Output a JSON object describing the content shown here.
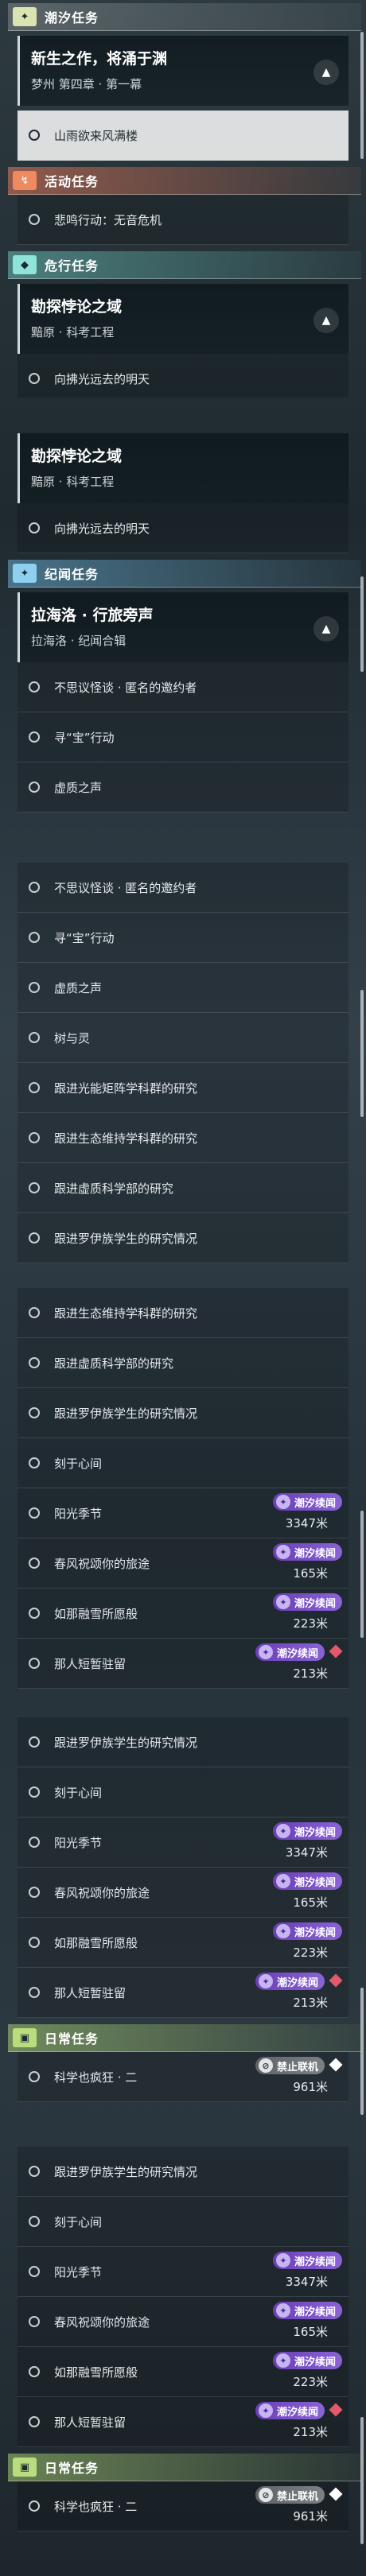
{
  "sections": {
    "tide": {
      "title": "潮汐任务",
      "icon": "star-icon",
      "glyph": "✦"
    },
    "activity": {
      "title": "活动任务",
      "icon": "event-icon",
      "glyph": "↯"
    },
    "danger": {
      "title": "危行任务",
      "icon": "hazard-icon",
      "glyph": "◆"
    },
    "epoch": {
      "title": "纪闻任务",
      "icon": "epoch-icon",
      "glyph": "✦"
    },
    "daily": {
      "title": "日常任务",
      "icon": "daily-icon",
      "glyph": "▣"
    }
  },
  "quests": {
    "main": {
      "title": "新生之作，将涌于渊",
      "subtitle": "梦州 第四章 · 第一幕"
    },
    "kantan": {
      "title": "勘探悖论之域",
      "subtitle": "黯原 · 科考工程"
    },
    "lahailuo": {
      "title": "拉海洛 · 行旅旁声",
      "subtitle": "拉海洛 · 纪闻合辑"
    }
  },
  "items": {
    "shanyu": "山雨欲来风满楼",
    "beiming": "悲鸣行动：无音危机",
    "xiangfu": "向拂光远去的明天",
    "bukeyi": "不思议怪谈 · 匿名的邀约者",
    "xunbao": "寻“宝”行动",
    "xuzhi": "虚质之声",
    "shuyuling": "树与灵",
    "guangneng": "跟进光能矩阵学科群的研究",
    "shengtai": "跟进生态维持学科群的研究",
    "xuzhike": "跟进虚质科学部的研究",
    "luoyi": "跟进罗伊族学生的研究情况",
    "xinjian": "刻于心间",
    "yangguang": "阳光季节",
    "chunfeng": "春风祝颂你的旅途",
    "naxue": "如那融雪所愿般",
    "narenjia": "那人短暂驻留",
    "kexue": "科学也疯狂 · 二"
  },
  "badges": {
    "tide_label": "潮汐续闻",
    "tide_icon": "tide-icon",
    "coop_label": "禁止联机",
    "coop_icon": "no-coop-icon"
  },
  "distances": {
    "yangguang": "3347米",
    "chunfeng": "165米",
    "naxue": "223米",
    "narenjia": "213米",
    "kexue": "961米"
  },
  "colors": {
    "tide_badge": "#7a4fc6",
    "track_marker": "#e2596b",
    "accent": "#d9e4b0"
  }
}
